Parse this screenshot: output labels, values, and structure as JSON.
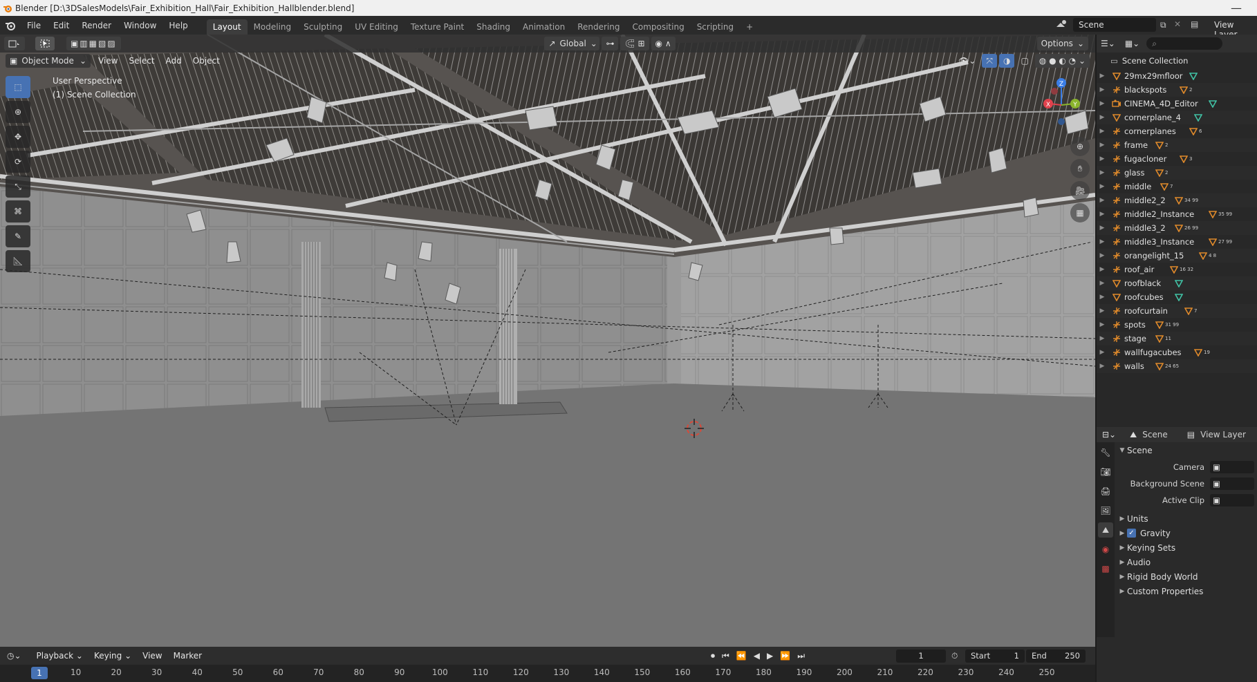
{
  "window": {
    "title": "Blender [D:\\3DSalesModels\\Fair_Exhibition_Hall\\Fair_Exhibition_Hallblender.blend]",
    "minimize": "—"
  },
  "menu": [
    "File",
    "Edit",
    "Render",
    "Window",
    "Help"
  ],
  "workspaces": [
    "Layout",
    "Modeling",
    "Sculpting",
    "UV Editing",
    "Texture Paint",
    "Shading",
    "Animation",
    "Rendering",
    "Compositing",
    "Scripting",
    "+"
  ],
  "active_workspace": "Layout",
  "top_right": {
    "scene": "Scene",
    "view_layer": "View Layer"
  },
  "viewport": {
    "transform_orientation": "Global",
    "options_label": "Options",
    "mode": "Object Mode",
    "menus": [
      "View",
      "Select",
      "Add",
      "Object"
    ],
    "overlay_line1": "User Perspective",
    "overlay_line2": "(1) Scene Collection",
    "gizmo_axes": {
      "x": "X",
      "y": "Y",
      "z": "Z"
    },
    "colors": {
      "x_axis": "#e0424d",
      "y_axis": "#8ab42c",
      "z_axis": "#3a7de6",
      "accent": "#4772b3"
    }
  },
  "outliner": {
    "root": "Scene Collection",
    "items": [
      {
        "name": "29mx29mfloor",
        "icon": "mesh-icon",
        "badge": ""
      },
      {
        "name": "blackspots",
        "icon": "empty-icon",
        "badge": "2"
      },
      {
        "name": "CINEMA_4D_Editor",
        "icon": "camera-icon",
        "badge": ""
      },
      {
        "name": "cornerplane_4",
        "icon": "mesh-icon",
        "badge": ""
      },
      {
        "name": "cornerplanes",
        "icon": "empty-icon",
        "badge": "6"
      },
      {
        "name": "frame",
        "icon": "empty-icon",
        "badge": "2"
      },
      {
        "name": "fugacloner",
        "icon": "empty-icon",
        "badge": "3"
      },
      {
        "name": "glass",
        "icon": "empty-icon",
        "badge": "2"
      },
      {
        "name": "middle",
        "icon": "empty-icon",
        "badge": "7"
      },
      {
        "name": "middle2_2",
        "icon": "empty-icon",
        "badge": "34 99"
      },
      {
        "name": "middle2_Instance",
        "icon": "empty-icon",
        "badge": "35 99"
      },
      {
        "name": "middle3_2",
        "icon": "empty-icon",
        "badge": "26 99"
      },
      {
        "name": "middle3_Instance",
        "icon": "empty-icon",
        "badge": "27 99"
      },
      {
        "name": "orangelight_15",
        "icon": "empty-icon",
        "badge": "4 8"
      },
      {
        "name": "roof_air",
        "icon": "empty-icon",
        "badge": "16 32"
      },
      {
        "name": "roofblack",
        "icon": "mesh-icon",
        "badge": ""
      },
      {
        "name": "roofcubes",
        "icon": "mesh-icon",
        "badge": ""
      },
      {
        "name": "roofcurtain",
        "icon": "empty-icon",
        "badge": "7"
      },
      {
        "name": "spots",
        "icon": "empty-icon",
        "badge": "31 99"
      },
      {
        "name": "stage",
        "icon": "empty-icon",
        "badge": "11"
      },
      {
        "name": "wallfugacubes",
        "icon": "empty-icon",
        "badge": "19"
      },
      {
        "name": "walls",
        "icon": "empty-icon",
        "badge": "24 65"
      }
    ]
  },
  "properties": {
    "scene": "Scene",
    "view_layer": "View Layer",
    "panel_title": "Scene",
    "fields": [
      {
        "label": "Camera",
        "icon": "camera-icon"
      },
      {
        "label": "Background Scene",
        "icon": "scene-icon"
      },
      {
        "label": "Active Clip",
        "icon": "clip-icon"
      }
    ],
    "panels": [
      "Units",
      "Gravity",
      "Keying Sets",
      "Audio",
      "Rigid Body World",
      "Custom Properties"
    ],
    "gravity_checked": true
  },
  "timeline": {
    "menus": [
      "Playback",
      "Keying",
      "View",
      "Marker"
    ],
    "current_frame": "1",
    "start_label": "Start",
    "start_value": "1",
    "end_label": "End",
    "end_value": "250",
    "ruler_labels": [
      "1",
      "10",
      "20",
      "30",
      "40",
      "50",
      "60",
      "70",
      "80",
      "90",
      "100",
      "110",
      "120",
      "130",
      "140",
      "150",
      "160",
      "170",
      "180",
      "190",
      "200",
      "210",
      "220",
      "230",
      "240",
      "250"
    ]
  }
}
